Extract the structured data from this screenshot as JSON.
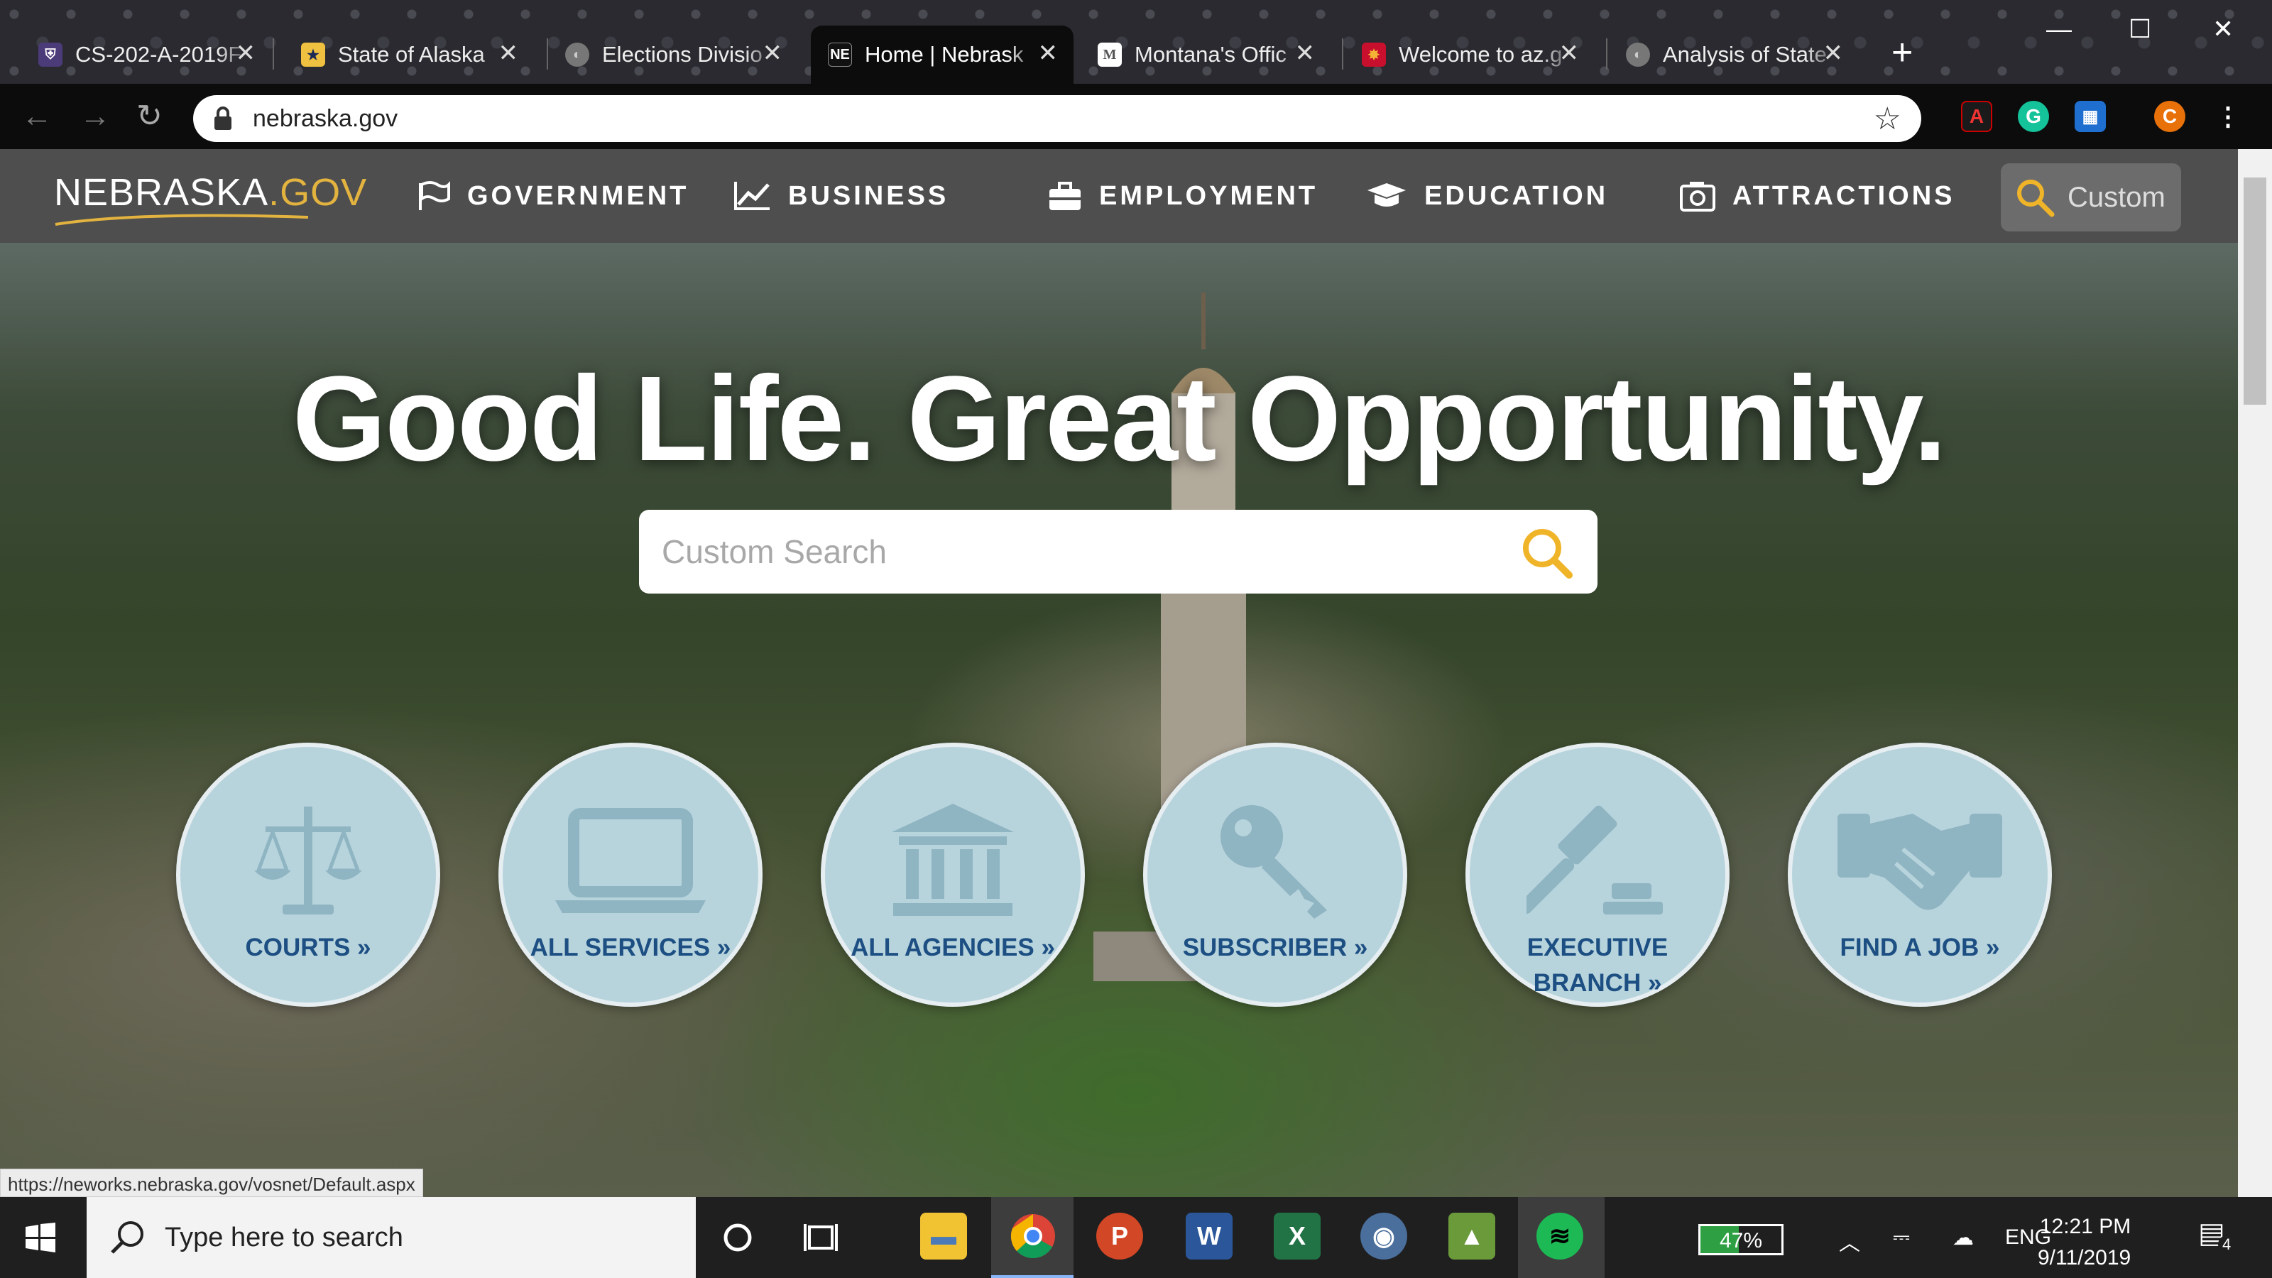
{
  "browser": {
    "tabs": [
      {
        "title": "CS-202-A-2019F",
        "favicon": "shield-icon"
      },
      {
        "title": "State of Alaska",
        "favicon": "alaska-seal-icon"
      },
      {
        "title": "Elections Divisio",
        "favicon": "globe-icon"
      },
      {
        "title": "Home | Nebrask",
        "favicon": "nebraska-logo-icon",
        "favicon_text": "NE"
      },
      {
        "title": "Montana's Offic",
        "favicon": "montana-m-icon",
        "favicon_text": "M"
      },
      {
        "title": "Welcome to az.g",
        "favicon": "arizona-icon"
      },
      {
        "title": "Analysis of State",
        "favicon": "globe-icon"
      }
    ],
    "active_tab_index": 3,
    "url": "nebraska.gov",
    "profile_initial": "C",
    "status_url": "https://neworks.nebraska.gov/vosnet/Default.aspx"
  },
  "site": {
    "logo_main": "NEBRASKA",
    "logo_suffix": ".GOV",
    "nav": [
      {
        "label": "GOVERNMENT",
        "icon": "flag-icon"
      },
      {
        "label": "BUSINESS",
        "icon": "chart-line-icon"
      },
      {
        "label": "EMPLOYMENT",
        "icon": "briefcase-icon"
      },
      {
        "label": "EDUCATION",
        "icon": "graduation-cap-icon"
      },
      {
        "label": "ATTRACTIONS",
        "icon": "camera-icon"
      }
    ],
    "header_search_label": "Custom",
    "headline": "Good Life. Great Opportunity.",
    "search_placeholder": "Custom Search",
    "quicklinks": [
      {
        "label": "COURTS »",
        "icon": "scales-icon"
      },
      {
        "label": "ALL SERVICES »",
        "icon": "laptop-icon"
      },
      {
        "label": "ALL AGENCIES »",
        "icon": "government-building-icon"
      },
      {
        "label": "SUBSCRIBER »",
        "icon": "key-icon"
      },
      {
        "label": "EXECUTIVE BRANCH »",
        "icon": "gavel-icon"
      },
      {
        "label": "FIND A JOB »",
        "icon": "handshake-icon"
      }
    ],
    "colors": {
      "header_bg": "#4e4e4e",
      "accent_gold": "#e3b340",
      "circle_bg": "#b7d4dd",
      "circle_text": "#1d4f83"
    }
  },
  "taskbar": {
    "search_placeholder": "Type here to search",
    "battery": "47%",
    "language": "ENG",
    "time": "12:21 PM",
    "date": "9/11/2019",
    "notifications": "4"
  }
}
